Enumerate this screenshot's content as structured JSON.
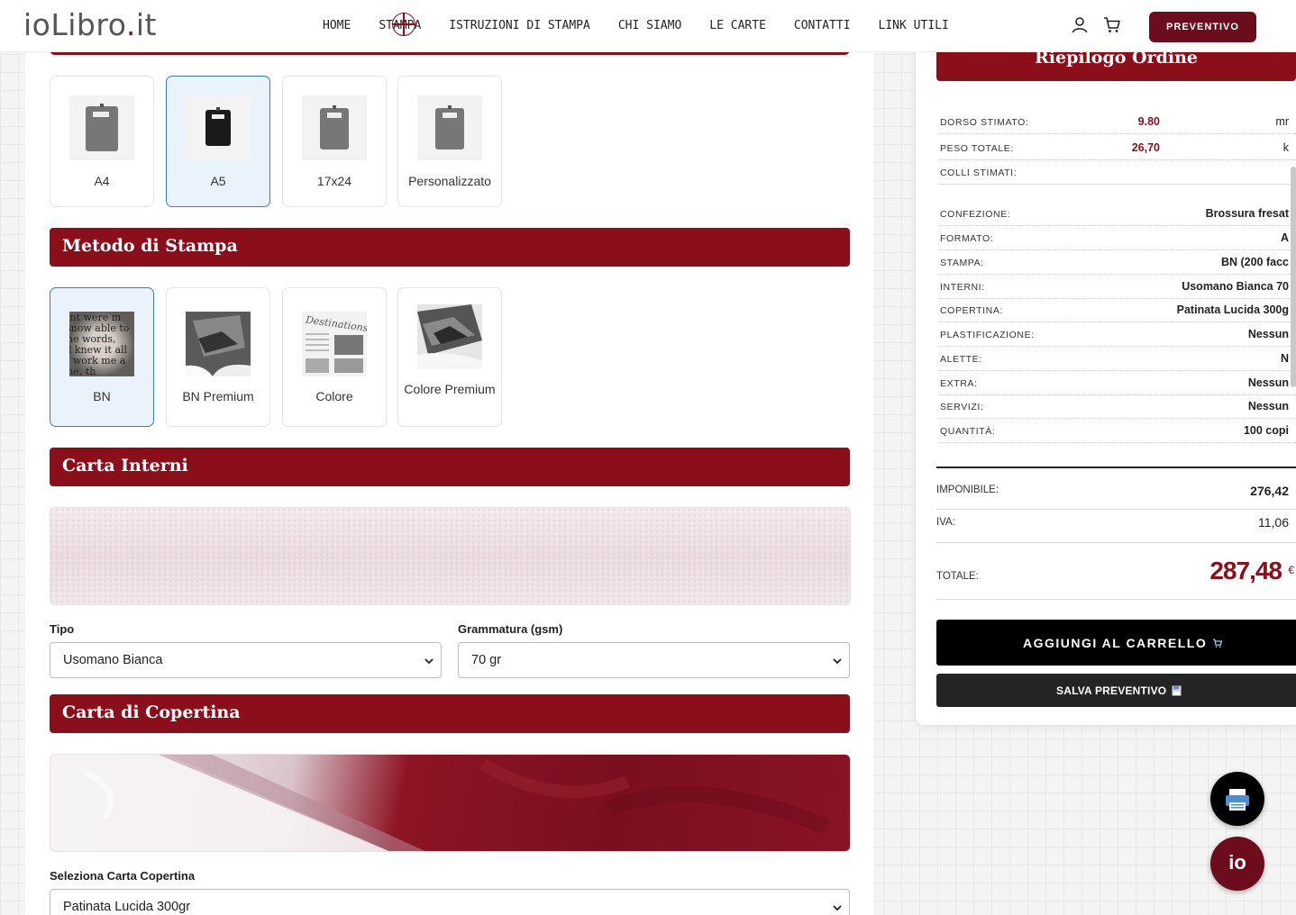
{
  "header": {
    "logo": {
      "main": "ioLibro",
      "dot": ".",
      "tld": "it"
    },
    "nav": [
      "HOME",
      "STAMPA",
      "ISTRUZIONI DI STAMPA",
      "CHI SIAMO",
      "LE CARTE",
      "CONTATTI",
      "LINK UTILI"
    ],
    "preventivo_label": "PREVENTIVO"
  },
  "formato": {
    "options": [
      {
        "label": "A4",
        "selected": false
      },
      {
        "label": "A5",
        "selected": true
      },
      {
        "label": "17x24",
        "selected": false
      },
      {
        "label": "Personalizzato",
        "selected": false
      }
    ]
  },
  "metodo": {
    "title": "Metodo di Stampa",
    "options": [
      {
        "label": "BN",
        "selected": true
      },
      {
        "label": "BN Premium",
        "selected": false
      },
      {
        "label": "Colore",
        "selected": false
      },
      {
        "label": "Colore Premium",
        "selected": false
      }
    ]
  },
  "carta_interni": {
    "title": "Carta Interni",
    "tipo_label": "Tipo",
    "tipo_value": "Usomano Bianca",
    "grammatura_label": "Grammatura (gsm)",
    "grammatura_value": "70 gr"
  },
  "carta_copertina": {
    "title": "Carta di Copertina",
    "select_label": "Seleziona Carta Copertina",
    "select_value": "Patinata Lucida 300gr"
  },
  "summary": {
    "title": "Riepilogo Ordine",
    "dorso_label": "DORSO STIMATO:",
    "dorso_value": "9.80",
    "dorso_unit": "mr",
    "peso_label": "PESO TOTALE:",
    "peso_value": "26,70",
    "peso_unit": "k",
    "colli_label": "COLLI STIMATI:",
    "details": [
      {
        "k": "CONFEZIONE:",
        "v": "Brossura fresat"
      },
      {
        "k": "FORMATO:",
        "v": "A"
      },
      {
        "k": "STAMPA:",
        "v": "BN (200 facc"
      },
      {
        "k": "INTERNI:",
        "v": "Usomano Bianca 70"
      },
      {
        "k": "COPERTINA:",
        "v": "Patinata Lucida 300g"
      },
      {
        "k": "PLASTIFICAZIONE:",
        "v": "Nessun"
      },
      {
        "k": "ALETTE:",
        "v": "N"
      },
      {
        "k": "EXTRA:",
        "v": "Nessun"
      },
      {
        "k": "SERVIZI:",
        "v": "Nessun"
      },
      {
        "k": "QUANTITÀ:",
        "v": "100 copi"
      }
    ],
    "imponibile_label": "IMPONIBILE:",
    "imponibile_value": "276,42",
    "iva_label": "IVA:",
    "iva_value": "11,06",
    "totale_label": "TOTALE:",
    "totale_value": "287,48",
    "totale_currency": "€",
    "add_cart_label": "AGGIUNGI AL CARRELLO",
    "save_label": "SALVA PREVENTIVO"
  },
  "fab": {
    "io_label": "io"
  },
  "colors": {
    "brand": "#8a0f1b",
    "brand_dark": "#6b0d1d",
    "selected_bg": "#eaf3fc",
    "selected_border": "#3b7bbd"
  },
  "icons": [
    "user-icon",
    "cart-icon",
    "chevron-down-icon",
    "printer-icon"
  ]
}
